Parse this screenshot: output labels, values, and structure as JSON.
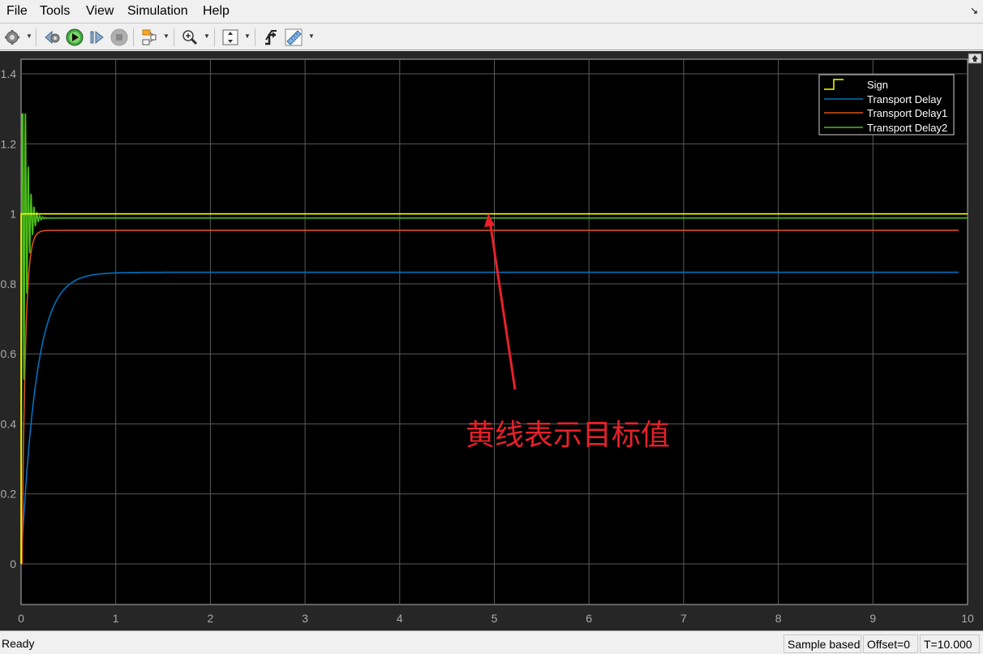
{
  "menu": {
    "items": [
      "File",
      "Tools",
      "View",
      "Simulation",
      "Help"
    ]
  },
  "toolbar": {
    "buttons": [
      {
        "icon": "gear-icon",
        "label": "Configuration Properties"
      },
      {
        "icon": "step-back-icon",
        "label": "Step Back"
      },
      {
        "icon": "run-icon",
        "label": "Run"
      },
      {
        "icon": "step-forward-icon",
        "label": "Step Forward"
      },
      {
        "icon": "stop-icon",
        "label": "Stop"
      },
      {
        "icon": "highlight-model-icon",
        "label": "Highlight Simulink Block"
      },
      {
        "icon": "zoom-in-icon",
        "label": "Zoom In"
      },
      {
        "icon": "scale-axes-icon",
        "label": "Scale Y-Axis Limits"
      },
      {
        "icon": "triggers-icon",
        "label": "Triggers"
      },
      {
        "icon": "measure-icon",
        "label": "Cursor Measurements"
      }
    ]
  },
  "colors": {
    "sign": "#ffff00",
    "transport_delay": "#0072bd",
    "transport_delay1": "#d95319",
    "transport_delay2": "#4dbb1a",
    "annotation": "#e8202a",
    "plot_bg": "#000000",
    "frame_bg": "#262626",
    "grid": "#5a5a5a"
  },
  "annotation": {
    "text": "黄线表示目标值",
    "points_to": {
      "x": 4.95,
      "y": 1.0
    }
  },
  "status": {
    "ready": "Ready",
    "mode": "Sample based",
    "offset": "Offset=0",
    "time": "T=10.000"
  },
  "chart_data": {
    "type": "line",
    "title": "",
    "xlabel": "",
    "ylabel": "",
    "xlim": [
      0,
      10
    ],
    "ylim": [
      -0.12,
      1.44
    ],
    "xticks": [
      0,
      1,
      2,
      3,
      4,
      5,
      6,
      7,
      8,
      9,
      10
    ],
    "yticks": [
      0,
      0.2,
      0.4,
      0.6,
      0.8,
      1,
      1.2,
      1.4
    ],
    "ytick_labels": [
      "0",
      "0.2",
      "0.4",
      "0.6",
      "0.8",
      "1",
      "1.2",
      "1.4"
    ],
    "xtick_labels": [
      "0",
      "1",
      "2",
      "3",
      "4",
      "5",
      "6",
      "7",
      "8",
      "9",
      "10"
    ],
    "grid": true,
    "legend": {
      "placement": "top-right",
      "entries": [
        "Sign",
        "Transport Delay",
        "Transport Delay1",
        "Transport Delay2"
      ]
    },
    "series": [
      {
        "name": "Sign",
        "style": "step",
        "x": [
          0,
          0,
          10
        ],
        "y": [
          0,
          1.0,
          1.0
        ]
      },
      {
        "name": "Transport Delay",
        "style": "first-order",
        "final_value": 0.833,
        "time_constant": 0.16,
        "x": [
          0,
          0.05,
          0.1,
          0.2,
          0.3,
          0.4,
          0.5,
          0.6,
          0.8,
          1.0,
          1.5,
          2,
          4,
          6,
          8,
          10
        ],
        "y": [
          0,
          0.22,
          0.39,
          0.6,
          0.71,
          0.77,
          0.8,
          0.815,
          0.828,
          0.832,
          0.833,
          0.833,
          0.833,
          0.833,
          0.833,
          0.833
        ]
      },
      {
        "name": "Transport Delay1",
        "style": "first-order",
        "final_value": 0.953,
        "time_constant": 0.035,
        "x": [
          0,
          0.02,
          0.04,
          0.06,
          0.08,
          0.1,
          0.15,
          0.2,
          0.3,
          0.5,
          1,
          10
        ],
        "y": [
          0,
          0.41,
          0.65,
          0.78,
          0.86,
          0.9,
          0.94,
          0.95,
          0.953,
          0.953,
          0.953,
          0.953
        ],
        "start": 0.01
      },
      {
        "name": "Transport Delay2",
        "style": "oscillatory",
        "final_value": 0.988,
        "x": [
          0,
          0.005,
          0.02,
          0.035,
          0.05,
          0.065,
          0.08,
          0.095,
          0.11,
          0.14,
          0.2,
          10
        ],
        "y": [
          0,
          0.6,
          1.285,
          0.9,
          1.015,
          0.97,
          0.995,
          0.982,
          0.99,
          0.987,
          0.988,
          0.988
        ]
      }
    ]
  }
}
